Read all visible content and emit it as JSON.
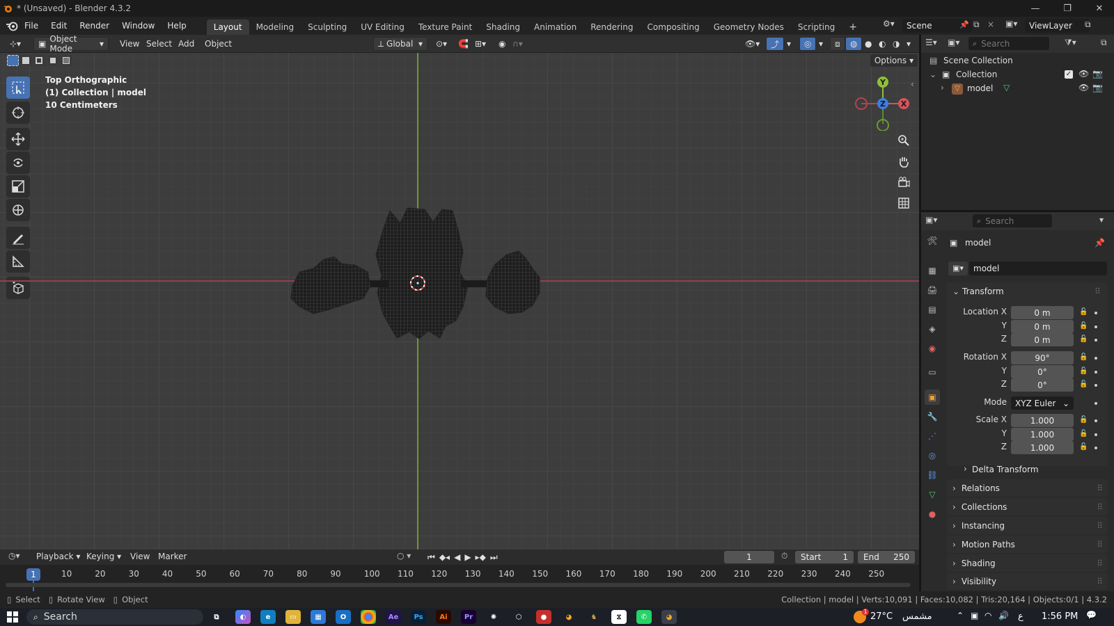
{
  "window": {
    "title": "* (Unsaved) - Blender 4.3.2",
    "controls": [
      "minimize",
      "restore",
      "close"
    ]
  },
  "menu": [
    "File",
    "Edit",
    "Render",
    "Window",
    "Help"
  ],
  "workspaces": [
    "Layout",
    "Modeling",
    "Sculpting",
    "UV Editing",
    "Texture Paint",
    "Shading",
    "Animation",
    "Rendering",
    "Compositing",
    "Geometry Nodes",
    "Scripting"
  ],
  "active_workspace": "Layout",
  "scene": {
    "label": "Scene",
    "view_layer": "ViewLayer"
  },
  "viewport_header": {
    "mode": "Object Mode",
    "menus": [
      "View",
      "Select",
      "Add",
      "Object"
    ],
    "orientation": "Global",
    "options_label": "Options"
  },
  "viewport": {
    "view_name": "Top Orthographic",
    "collection_info": "(1) Collection | model",
    "scale": "10 Centimeters",
    "gizmo_axes": [
      "Y",
      "Z",
      "X"
    ]
  },
  "outliner": {
    "search_placeholder": "Search",
    "root": "Scene Collection",
    "collection": "Collection",
    "object": "model"
  },
  "properties": {
    "search_placeholder": "Search",
    "object_name": "model",
    "datablock_name": "model",
    "transform": {
      "header": "Transform",
      "location_label": "Location X",
      "rotation_label": "Rotation X",
      "scale_label": "Scale X",
      "y_label": "Y",
      "z_label": "Z",
      "location": [
        "0 m",
        "0 m",
        "0 m"
      ],
      "rotation": [
        "90°",
        "0°",
        "0°"
      ],
      "mode_label": "Mode",
      "mode": "XYZ Euler",
      "scale": [
        "1.000",
        "1.000",
        "1.000"
      ]
    },
    "subpanels": [
      "Delta Transform"
    ],
    "panels": [
      "Relations",
      "Collections",
      "Instancing",
      "Motion Paths",
      "Shading",
      "Visibility"
    ]
  },
  "timeline": {
    "menus": [
      "Playback",
      "Keying",
      "View",
      "Marker"
    ],
    "current_frame": "1",
    "start_label": "Start",
    "start": "1",
    "end_label": "End",
    "end": "250",
    "ticks": [
      "10",
      "20",
      "30",
      "40",
      "50",
      "60",
      "70",
      "80",
      "90",
      "100",
      "110",
      "120",
      "130",
      "140",
      "150",
      "160",
      "170",
      "180",
      "190",
      "200",
      "210",
      "220",
      "230",
      "240",
      "250"
    ]
  },
  "status_bar": {
    "hints": [
      "Select",
      "Rotate View",
      "Object"
    ],
    "stats": "Collection | model | Verts:10,091 | Faces:10,082 | Tris:20,164 | Objects:0/1 | 4.3.2"
  },
  "taskbar": {
    "search": "Search",
    "weather_temp": "27°C",
    "weather_text": "مشمس",
    "lang": "ع",
    "time": "1:56 PM",
    "notification_badge": "1"
  }
}
